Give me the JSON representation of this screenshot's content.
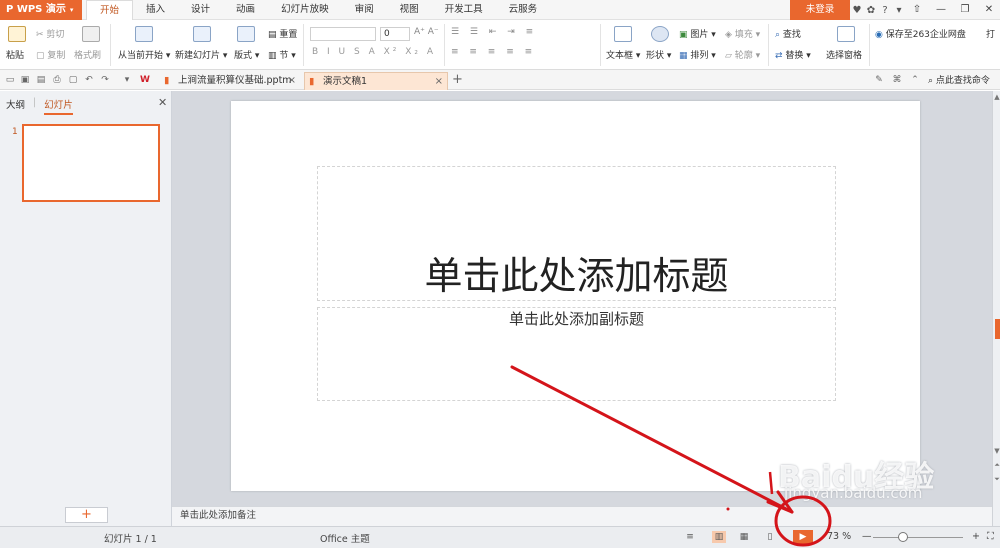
{
  "app": {
    "name": "WPS 演示"
  },
  "menu": {
    "tabs": [
      "开始",
      "插入",
      "设计",
      "动画",
      "幻灯片放映",
      "审阅",
      "视图",
      "开发工具",
      "云服务"
    ],
    "login": "未登录"
  },
  "ribbon": {
    "paste": "粘贴",
    "cut": "剪切",
    "copy": "复制",
    "format_painter": "格式刷",
    "from_current": "从当前开始",
    "new_slide": "新建幻灯片",
    "layout": "版式",
    "section": "节",
    "reset": "重置",
    "font_size": "0",
    "text_box": "文本框",
    "shape": "形状",
    "arrange": "排列",
    "picture": "图片",
    "fill": "填充",
    "outline": "轮廓",
    "find": "查找",
    "replace": "替换",
    "select_pane": "选择窗格",
    "save_cloud": "保存至263企业网盘",
    "overflow": "打"
  },
  "quickbar": {
    "find_command": "点此查找命令"
  },
  "tabs": [
    {
      "label": "上涧流量积算仪基础.pptm",
      "close": "×"
    },
    {
      "label": "演示文稿1",
      "close": "×"
    }
  ],
  "left_pane": {
    "tab_outline": "大纲",
    "tab_slides": "幻灯片",
    "slide_number": "1",
    "add": "+"
  },
  "slide": {
    "title": "单击此处添加标题",
    "subtitle": "单击此处添加副标题"
  },
  "notes": {
    "placeholder": "单击此处添加备注"
  },
  "status": {
    "slide_info": "幻灯片 1 / 1",
    "theme": "Office 主题",
    "zoom": "73 %"
  },
  "zoom": {
    "level": 0.33
  },
  "watermark": {
    "brand": "Baidu经验",
    "url": "jingyan.baidu.com"
  },
  "colors": {
    "accent": "#e9672e",
    "annotation": "#d4141a"
  }
}
